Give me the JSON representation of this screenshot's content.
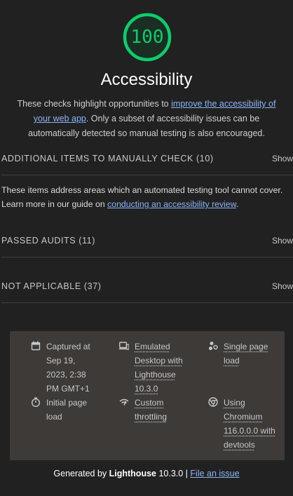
{
  "score": {
    "value": "100",
    "fraction": 1.0,
    "color": "#0cce6b"
  },
  "category": {
    "title": "Accessibility",
    "desc_before": "These checks highlight opportunities to ",
    "desc_link": "improve the accessibility of your web app",
    "desc_after": ". Only a subset of accessibility issues can be automatically detected so manual testing is also encouraged."
  },
  "groups": {
    "manual": {
      "title": "ADDITIONAL ITEMS TO MANUALLY CHECK (10)",
      "toggle": "Show",
      "desc_before": "These items address areas which an automated testing tool cannot cover. Learn more in our guide on ",
      "desc_link": "conducting an accessibility review",
      "desc_after": "."
    },
    "passed": {
      "title": "PASSED AUDITS (11)",
      "toggle": "Show"
    },
    "not_applicable": {
      "title": "NOT APPLICABLE (37)",
      "toggle": "Show"
    }
  },
  "environment": {
    "captured": {
      "icon": "calendar-icon",
      "line1": "Captured at",
      "line2": "Sep 19,",
      "line3": "2023, 2:38",
      "line4": "PM GMT+1"
    },
    "device": {
      "icon": "desktop-icon",
      "line1": "Emulated",
      "line2": "Desktop with",
      "line3": "Lighthouse",
      "line4": "10.3.0"
    },
    "page_load": {
      "icon": "single-page-load-icon",
      "line1": "Single page",
      "line2": "load"
    },
    "initial": {
      "icon": "timer-icon",
      "line1": "Initial page",
      "line2": "load"
    },
    "throttling": {
      "icon": "network-throttling-icon",
      "line1": "Custom",
      "line2": "throttling"
    },
    "browser": {
      "icon": "chrome-icon",
      "line1": "Using",
      "line2": "Chromium",
      "line3": "116.0.0.0 with",
      "line4": "devtools"
    }
  },
  "footer": {
    "generated_by": "Generated by ",
    "product": "Lighthouse",
    "version": " 10.3.0 | ",
    "issue_link": "File an issue"
  }
}
